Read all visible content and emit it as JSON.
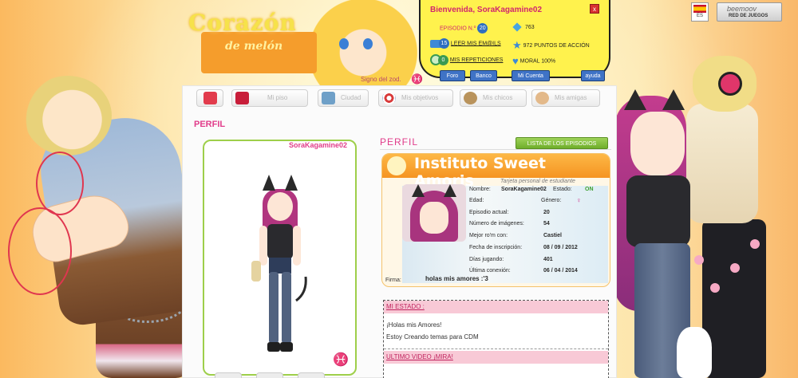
{
  "logo": {
    "main": "Corazón",
    "sub": "de melón"
  },
  "signo": {
    "label": "Signo del zod.",
    "icon": "♓"
  },
  "user_panel": {
    "welcome": "Bienvenida, SoraKagamine02",
    "close": "x",
    "episode_label": "EPISODIO N.º",
    "episode_num": "20",
    "mail_count": "15",
    "mail_label": "LEER MIS EM@ILS",
    "rep_count": "0",
    "rep_label": "MIS REPETICIONES",
    "money": "763",
    "action_points": "972 PUNTOS DE ACCIÓN",
    "moral": "MORAL 100%",
    "buttons": [
      "Foro",
      "Banco",
      "Mi Cuenta",
      "ayuda"
    ]
  },
  "lang": {
    "code": "ES"
  },
  "beemoov": {
    "name": "beemoov",
    "sub": "RED DE JUEGOS"
  },
  "nav": {
    "tabs": [
      {
        "label": "",
        "icon": "home-icon",
        "color": "#e23b4c"
      },
      {
        "label": "Mi piso",
        "icon": "sofa-icon",
        "color": "#c81e3a"
      },
      {
        "label": "Ciudad",
        "icon": "city-icon",
        "color": "#6fa0c8"
      },
      {
        "label": "Mis objetivos",
        "icon": "target-icon",
        "color": "#d93b3b"
      },
      {
        "label": "Mis chicos",
        "icon": "boy-icon",
        "color": "#b9935c"
      },
      {
        "label": "Mis amigas",
        "icon": "girl-icon",
        "color": "#e3b98a"
      }
    ]
  },
  "profile": {
    "section_title": "PERFIL",
    "avatar_name": "SoraKagamine02",
    "profile_title": "PERFIL",
    "episodes_button": "LISTA DE LOS EPISODIOS",
    "card_title": "Instituto Sweet Amoris",
    "card_sub": "Tarjeta personal de estudiante",
    "fields": [
      {
        "label": "Nombre:",
        "value": "SoraKagamine02"
      },
      {
        "label": "Estado:",
        "value": "ON"
      },
      {
        "label": "Edad:",
        "value": ""
      },
      {
        "label": "Género:",
        "value": "♀"
      },
      {
        "label": "Episodio actual:",
        "value": "20"
      },
      {
        "label": "Número de imágenes:",
        "value": "54"
      },
      {
        "label": "Mejor ro'm con:",
        "value": "Castiel"
      },
      {
        "label": "Fecha de inscripción:",
        "value": "08 / 09 / 2012"
      },
      {
        "label": "Días jugando:",
        "value": "401"
      },
      {
        "label": "Última conexión:",
        "value": "06 / 04 / 2014"
      }
    ],
    "firma_label": "Firma:",
    "firma_value": "holas mis amores :'3"
  },
  "state": {
    "title": "MI ESTADO :",
    "line1": "¡Holas mis Amores!",
    "line2": "Estoy Creando temas para CDM",
    "video_title": "ULTIMO VIDEO ¡MIRA!"
  },
  "colors": {
    "accent": "#e13c8a",
    "panel_yellow": "#fff24d",
    "green": "#9ecf4a"
  }
}
